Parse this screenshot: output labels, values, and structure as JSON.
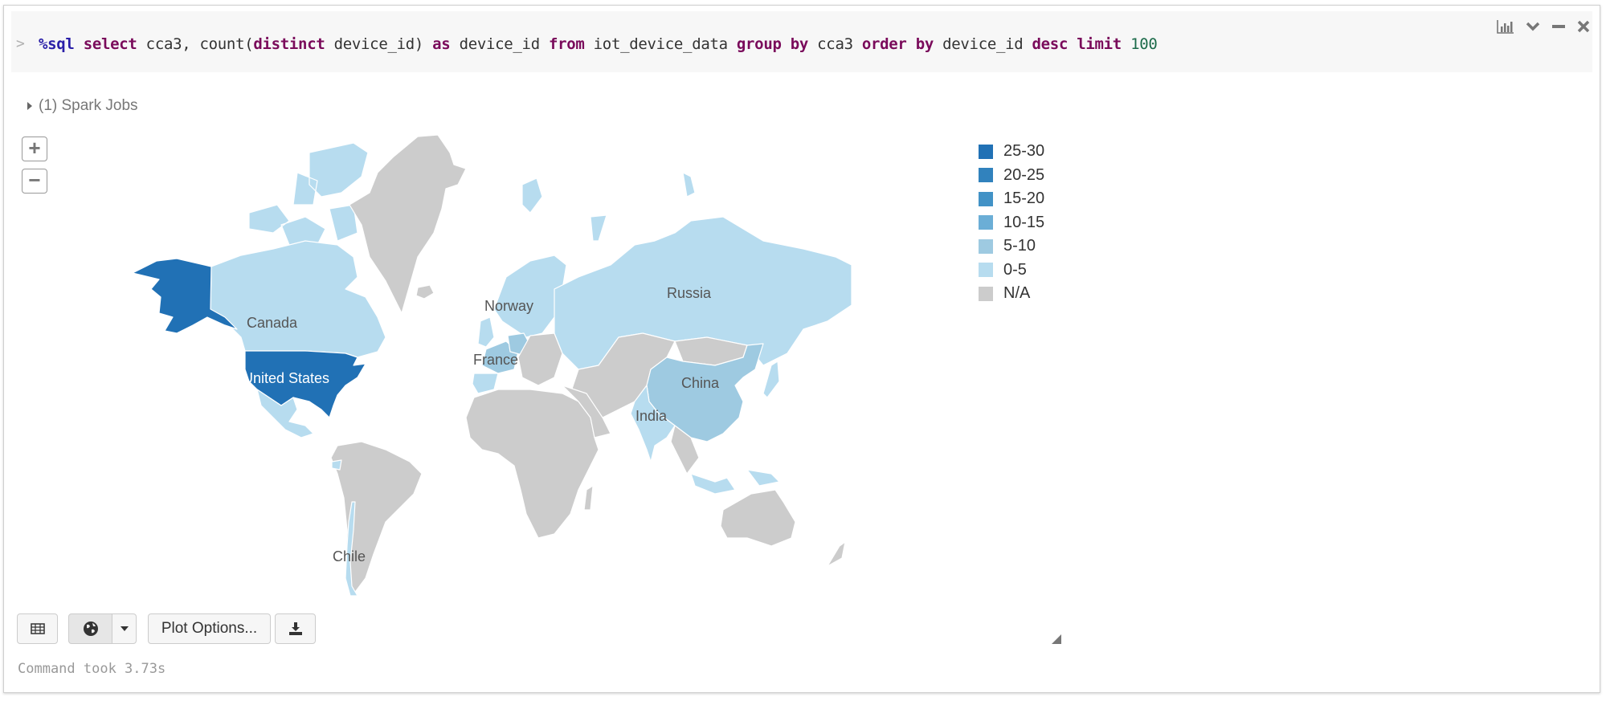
{
  "cell": {
    "prompt": ">",
    "code_tokens": [
      {
        "t": "%sql",
        "c": "kw-magic"
      },
      {
        "t": " ",
        "c": ""
      },
      {
        "t": "select",
        "c": "kw"
      },
      {
        "t": " cca3, count(",
        "c": ""
      },
      {
        "t": "distinct",
        "c": "kw"
      },
      {
        "t": " device_id) ",
        "c": ""
      },
      {
        "t": "as",
        "c": "kw"
      },
      {
        "t": " device_id ",
        "c": ""
      },
      {
        "t": "from",
        "c": "kw"
      },
      {
        "t": " iot_device_data ",
        "c": ""
      },
      {
        "t": "group by",
        "c": "kw"
      },
      {
        "t": " cca3 ",
        "c": ""
      },
      {
        "t": "order by",
        "c": "kw"
      },
      {
        "t": " device_id ",
        "c": ""
      },
      {
        "t": "desc",
        "c": "kw"
      },
      {
        "t": " ",
        "c": ""
      },
      {
        "t": "limit",
        "c": "kw"
      },
      {
        "t": " ",
        "c": ""
      },
      {
        "t": "100",
        "c": "num"
      }
    ],
    "tools": [
      "chart-icon",
      "chevron-down-icon",
      "minimize-icon",
      "close-icon"
    ]
  },
  "spark_jobs": {
    "label": "(1) Spark Jobs"
  },
  "map_controls": {
    "zoom_in": "+",
    "zoom_out": "−"
  },
  "legend": {
    "items": [
      {
        "label": "25-30",
        "color": "#2171b5"
      },
      {
        "label": "20-25",
        "color": "#3182bd"
      },
      {
        "label": "15-20",
        "color": "#4292c6"
      },
      {
        "label": "10-15",
        "color": "#6baed6"
      },
      {
        "label": "5-10",
        "color": "#9ecae1"
      },
      {
        "label": "0-5",
        "color": "#b7dcef"
      },
      {
        "label": "N/A",
        "color": "#cccccc"
      }
    ]
  },
  "map": {
    "labels": {
      "canada": "Canada",
      "united_states": "United States",
      "norway": "Norway",
      "france": "France",
      "russia": "Russia",
      "china": "China",
      "india": "India",
      "chile": "Chile"
    },
    "country_bins": {
      "united_states": "25-30",
      "canada": "0-5",
      "russia": "0-5",
      "china": "5-10",
      "france": "5-10",
      "germany": "5-10",
      "norway": "0-5",
      "india": "0-5",
      "chile": "0-5",
      "greenland": "N/A",
      "africa": "N/A",
      "australia": "N/A",
      "south_america_other": "N/A"
    }
  },
  "toolbar": {
    "table_icon": "table-icon",
    "globe_icon": "globe-icon",
    "plot_options": "Plot Options...",
    "download_icon": "download-icon"
  },
  "status": {
    "text": "Command took 3.73s"
  }
}
